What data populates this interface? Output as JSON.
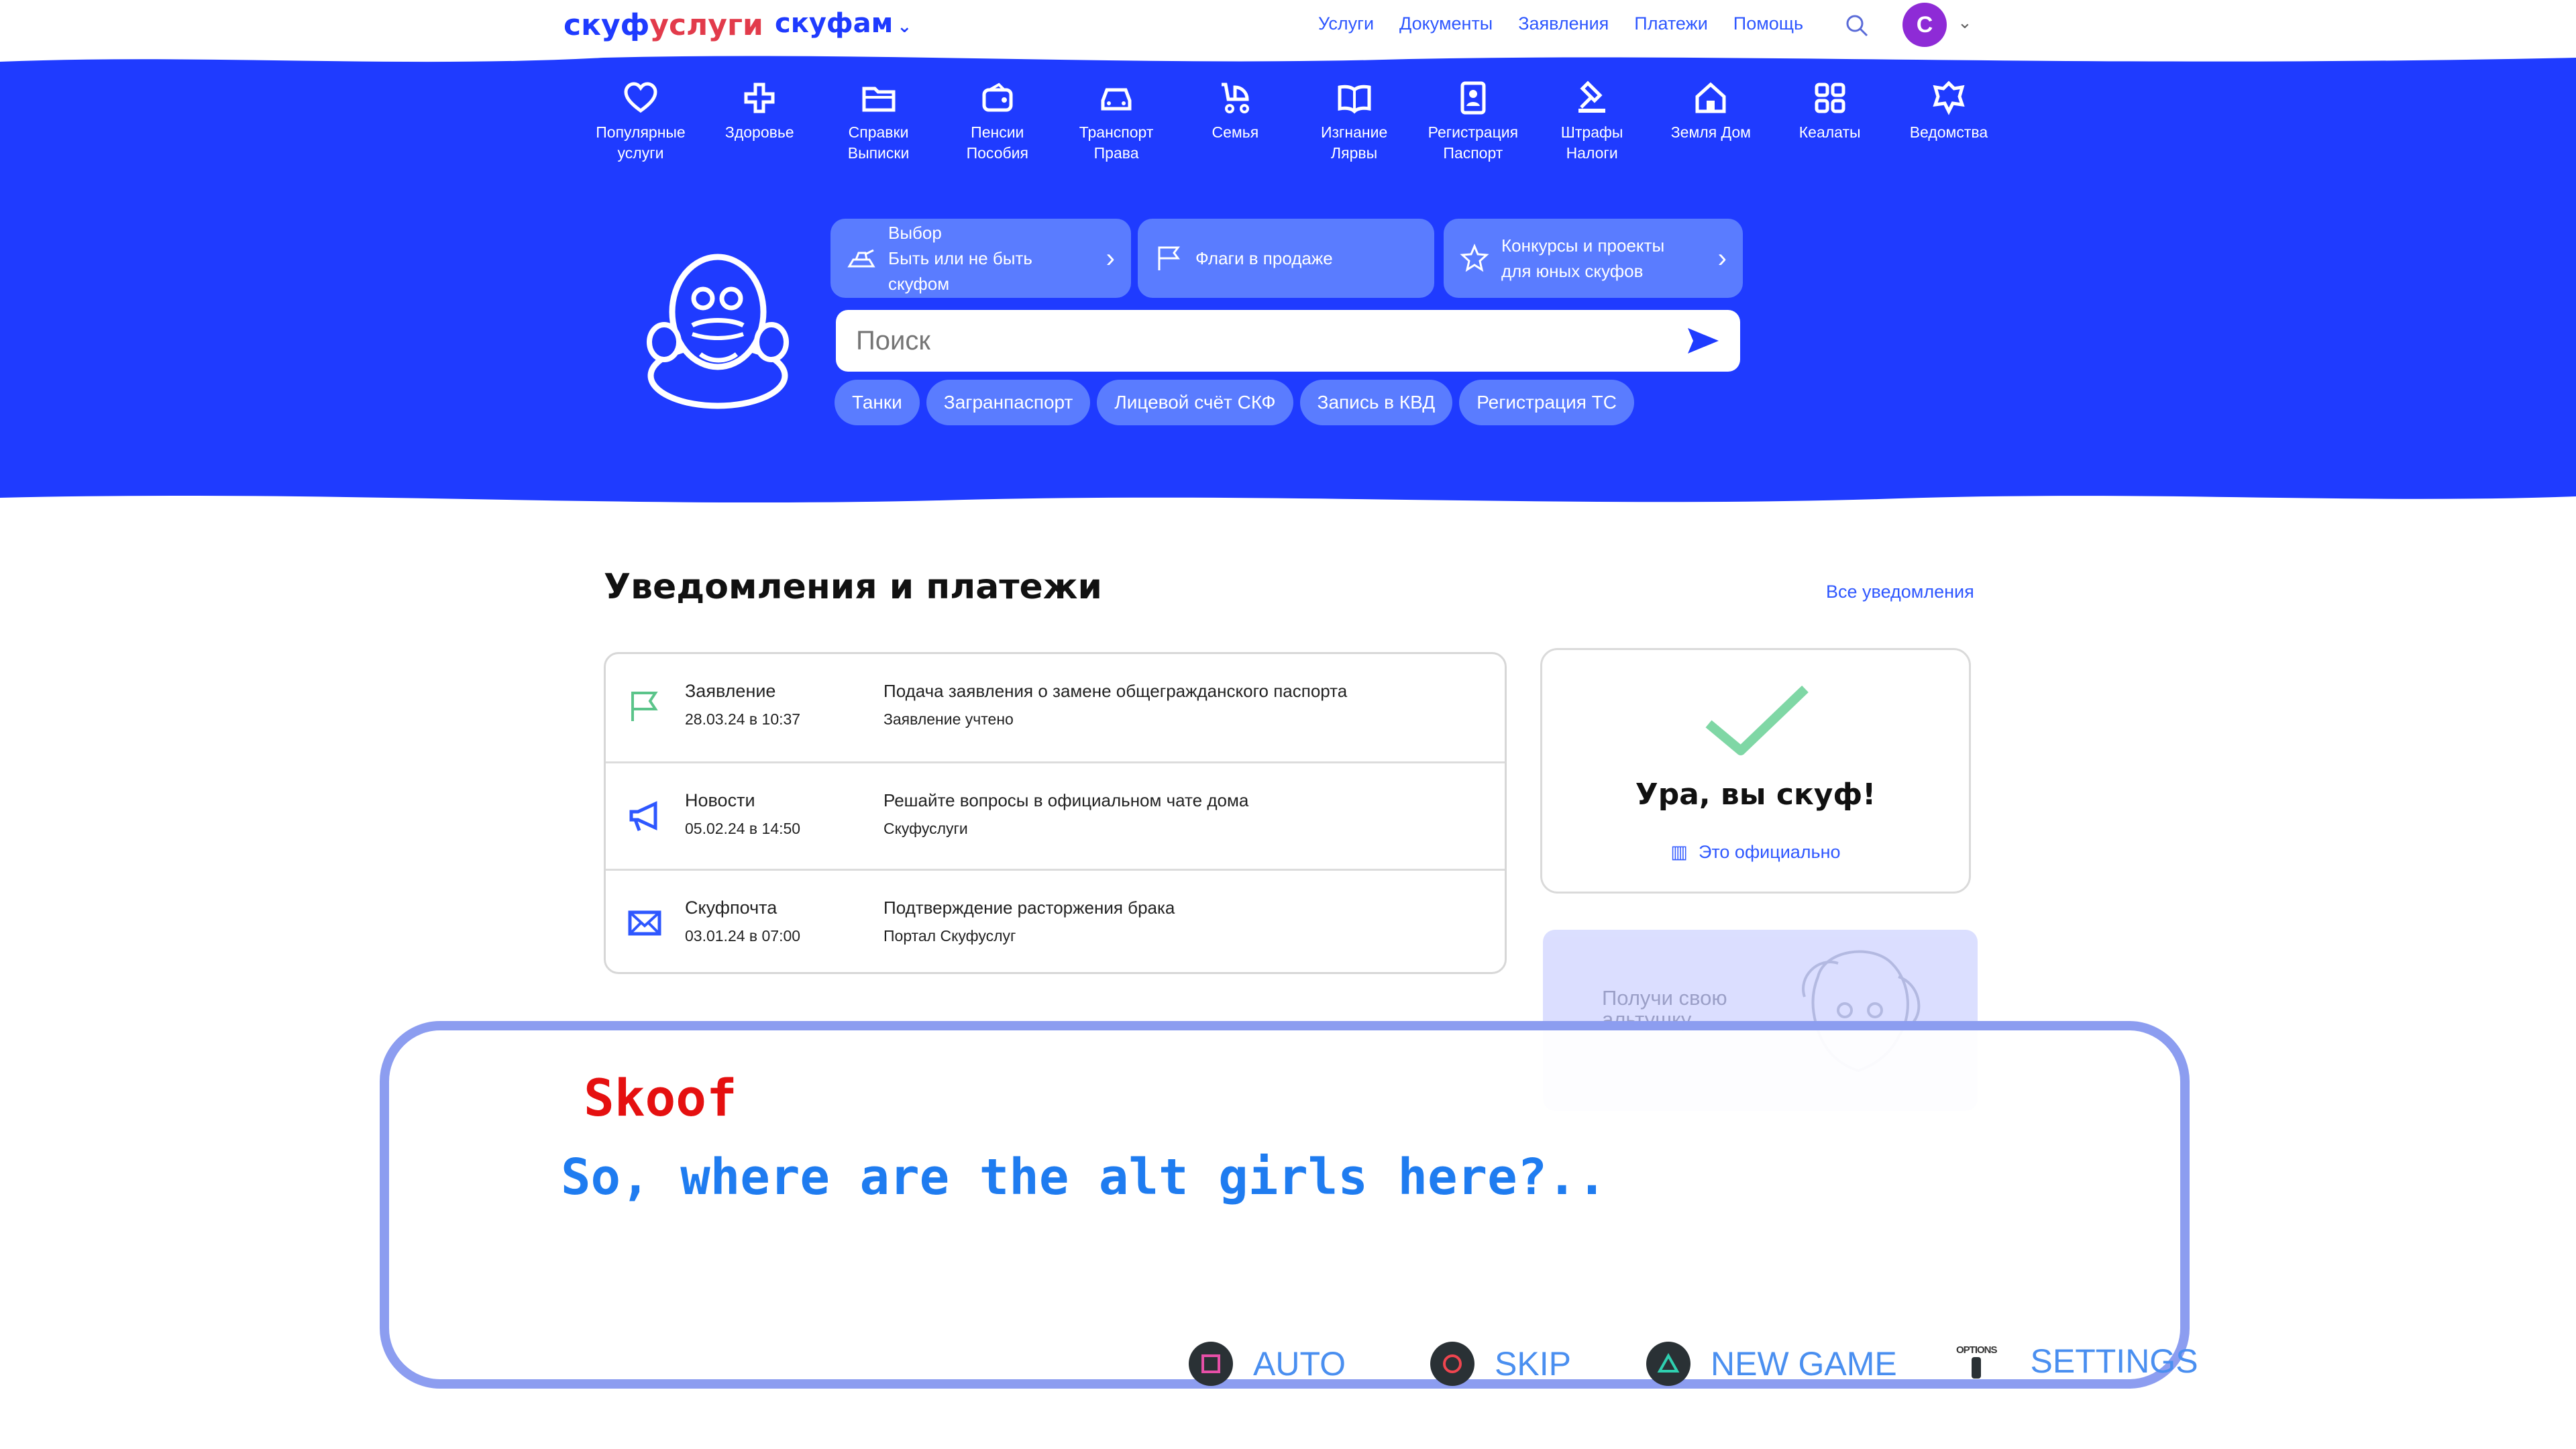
{
  "header": {
    "logo_part1": "скуф",
    "logo_part2": "услуги",
    "family_logo": "скуфам",
    "nav": [
      "Услуги",
      "Документы",
      "Заявления",
      "Платежи",
      "Помощь"
    ],
    "avatar_letter": "С"
  },
  "categories": [
    {
      "line1": "Популярные",
      "line2": "услуги",
      "icon": "heart-icon"
    },
    {
      "line1": "Здоровье",
      "line2": "",
      "icon": "medical-cross-icon"
    },
    {
      "line1": "Справки",
      "line2": "Выписки",
      "icon": "folder-icon"
    },
    {
      "line1": "Пенсии",
      "line2": "Пособия",
      "icon": "wallet-icon"
    },
    {
      "line1": "Транспорт",
      "line2": "Права",
      "icon": "car-icon"
    },
    {
      "line1": "Семья",
      "line2": "",
      "icon": "stroller-icon"
    },
    {
      "line1": "Изгнание",
      "line2": "Лярвы",
      "icon": "book-icon"
    },
    {
      "line1": "Регистрация",
      "line2": "Паспорт",
      "icon": "id-card-icon"
    },
    {
      "line1": "Штрафы",
      "line2": "Налоги",
      "icon": "gavel-icon"
    },
    {
      "line1": "Земля Дом",
      "line2": "",
      "icon": "house-icon"
    },
    {
      "line1": "Кеалаты",
      "line2": "",
      "icon": "grid-icon"
    },
    {
      "line1": "Ведомства",
      "line2": "",
      "icon": "emblem-icon"
    }
  ],
  "promos": [
    {
      "line1": "Выбор",
      "line2": "Быть или не быть скуфом"
    },
    {
      "line1": "Флаги в продаже",
      "line2": ""
    },
    {
      "line1": "Конкурсы и проекты",
      "line2": "для юных скуфов"
    }
  ],
  "search": {
    "placeholder": "Поиск"
  },
  "chips": [
    "Танки",
    "Загранпаспорт",
    "Лицевой счёт СКФ",
    "Запись в КВД",
    "Регистрация ТС"
  ],
  "notifications": {
    "title": "Уведомления и платежи",
    "all_link": "Все уведомления",
    "items": [
      {
        "category": "Заявление",
        "date": "28.03.24 в 10:37",
        "title": "Подача заявления о замене общегражданского паспорта",
        "sub": "Заявление учтено"
      },
      {
        "category": "Новости",
        "date": "05.02.24 в 14:50",
        "title": "Решайте вопросы в официальном чате дома",
        "sub": "Скуфуслуги"
      },
      {
        "category": "Скуфпочта",
        "date": "03.01.24 в 07:00",
        "title": "Подтверждение расторжения брака",
        "sub": "Портал Скуфуслуг"
      }
    ]
  },
  "success_card": {
    "title": "Ура, вы скуф!",
    "link": "Это официально"
  },
  "alt_card": {
    "line1": "Получи свою",
    "line2": "альтушку"
  },
  "dialogue": {
    "speaker": "Skoof",
    "text": "So, where are the alt girls here?.."
  },
  "controls": {
    "auto": "AUTO",
    "skip": "SKIP",
    "new_game": "NEW GAME",
    "options_label": "OPTIONS",
    "settings": "SETTINGS"
  },
  "colors": {
    "brand_blue": "#1f3bff",
    "speaker_red": "#e51010",
    "dialog_text": "#1f7cf0",
    "dialog_border": "#8c9df0"
  }
}
